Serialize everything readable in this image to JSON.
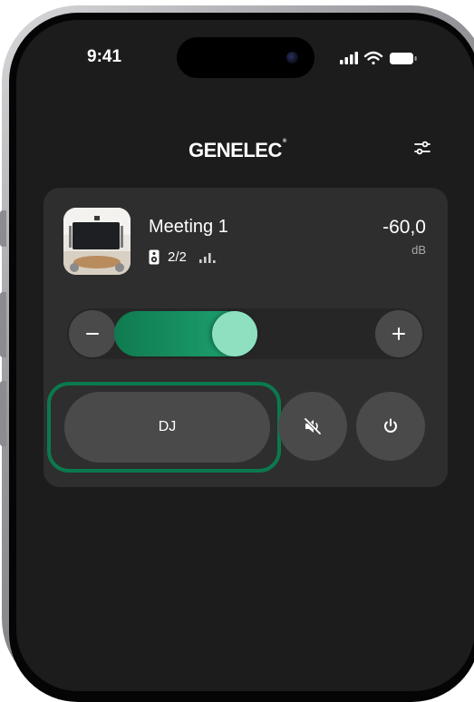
{
  "status_bar": {
    "time": "9:41",
    "icons": [
      "signal-icon",
      "wifi-icon",
      "battery-icon"
    ]
  },
  "header": {
    "brand": "GENELEC",
    "brand_mark": "®",
    "settings_icon": "sliders-icon"
  },
  "device": {
    "name": "Meeting 1",
    "speakers": "2/2",
    "volume_value": "-60,0",
    "volume_unit": "dB",
    "volume_level": 0.35,
    "thumbnail": "meeting-room-thumbnail"
  },
  "controls": {
    "preset_label": "DJ",
    "mute_icon": "speaker-mute-icon",
    "power_icon": "power-icon",
    "decrease_icon": "minus-icon",
    "increase_icon": "plus-icon"
  },
  "colors": {
    "accent": "#1fa874",
    "thumb": "#8fe0c0",
    "highlight": "#0a7a4e",
    "card": "#2e2e2e"
  }
}
